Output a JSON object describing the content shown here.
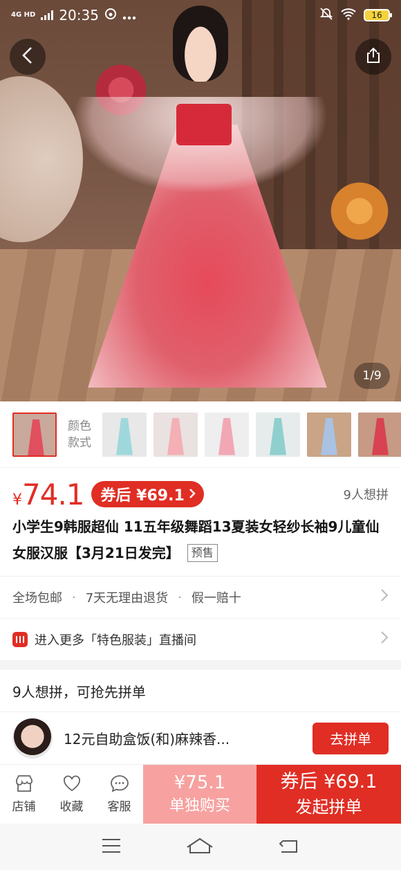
{
  "status_bar": {
    "network": "4G HD",
    "time": "20:35",
    "battery": "16"
  },
  "gallery": {
    "page_indicator": "1/9"
  },
  "variants": {
    "label": "颜色\n款式",
    "label_line1": "颜色",
    "label_line2": "款式",
    "thumbs": [
      {
        "dress_color": "#e0505e",
        "bg": "#c9a99b"
      },
      {
        "dress_color": "#9fd8dc",
        "bg": "#e8e8e8"
      },
      {
        "dress_color": "#f4b0b5",
        "bg": "#e9e2e0"
      },
      {
        "dress_color": "#f2a7b5",
        "bg": "#eee"
      },
      {
        "dress_color": "#8fd0cf",
        "bg": "#e6ecec"
      },
      {
        "dress_color": "#a9c2e2",
        "bg": "#c9a486"
      },
      {
        "dress_color": "#d84252",
        "bg": "#c69a84"
      }
    ]
  },
  "price": {
    "currency": "¥",
    "value": "74.1",
    "coupon_text": "券后 ¥69.1",
    "want_count": "9人想拼"
  },
  "product": {
    "title": "小学生9韩服超仙 11五年级舞蹈13夏装女轻纱长袖9儿童仙女服汉服【3月21日发完】",
    "presale_tag": "预售"
  },
  "services": {
    "items": [
      "全场包邮",
      "7天无理由退货",
      "假一赔十"
    ]
  },
  "live": {
    "text": "进入更多「特色服装」直播间"
  },
  "group": {
    "header": "9人想拼，可抢先拼单",
    "member_name": "12元自助盒饭(和)麻辣香...",
    "join_label": "去拼单"
  },
  "bottom_bar": {
    "store": "店铺",
    "favorite": "收藏",
    "service": "客服",
    "solo_price": "¥75.1",
    "solo_label": "单独购买",
    "group_price": "券后 ¥69.1",
    "group_label": "发起拼单"
  },
  "colors": {
    "accent": "#e02e24",
    "solo_bg": "#f7a2a0"
  }
}
